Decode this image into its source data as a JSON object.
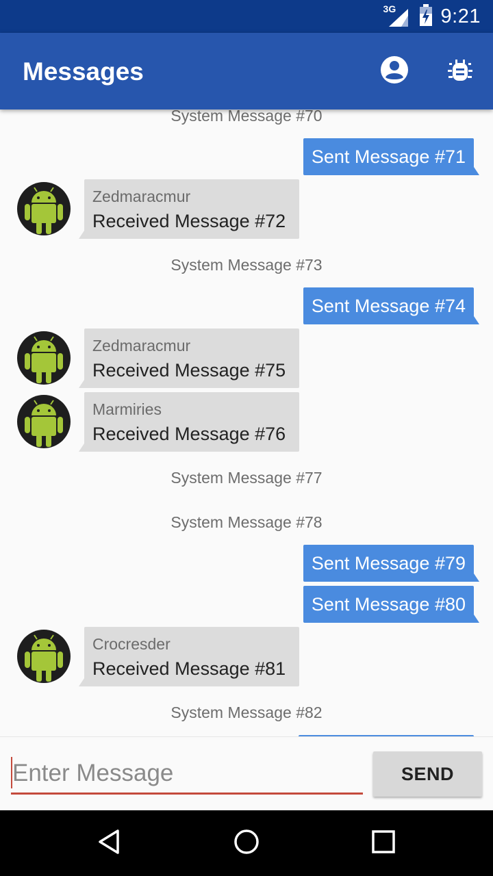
{
  "status_bar": {
    "network": "3G",
    "time": "9:21",
    "icons": [
      "signal-icon",
      "battery-icon"
    ]
  },
  "app_bar": {
    "title": "Messages",
    "actions": [
      "account-icon",
      "bug-icon"
    ]
  },
  "messages": [
    {
      "type": "system",
      "text": "System Message #70"
    },
    {
      "type": "sent",
      "text": "Sent Message #71"
    },
    {
      "type": "received",
      "sender": "Zedmaracmur",
      "text": "Received Message #72"
    },
    {
      "type": "system",
      "text": "System Message #73"
    },
    {
      "type": "sent",
      "text": "Sent Message #74"
    },
    {
      "type": "received",
      "sender": "Zedmaracmur",
      "text": "Received Message #75"
    },
    {
      "type": "received",
      "sender": "Marmiries",
      "text": "Received Message #76"
    },
    {
      "type": "system",
      "text": "System Message #77"
    },
    {
      "type": "system",
      "text": "System Message #78"
    },
    {
      "type": "sent",
      "text": "Sent Message #79"
    },
    {
      "type": "sent",
      "text": "Sent Message #80"
    },
    {
      "type": "received",
      "sender": "Crocresder",
      "text": "Received Message #81"
    },
    {
      "type": "system",
      "text": "System Message #82"
    }
  ],
  "composer": {
    "placeholder": "Enter Message",
    "value": "",
    "send_label": "SEND"
  },
  "nav_bar": {
    "buttons": [
      "back-icon",
      "home-icon",
      "recents-icon"
    ]
  },
  "colors": {
    "status_bar": "#0d3a8a",
    "app_bar": "#2756ad",
    "sent_bubble": "#4a8bdf",
    "received_bubble": "#dcdcdc",
    "input_underline": "#c44a3c"
  }
}
